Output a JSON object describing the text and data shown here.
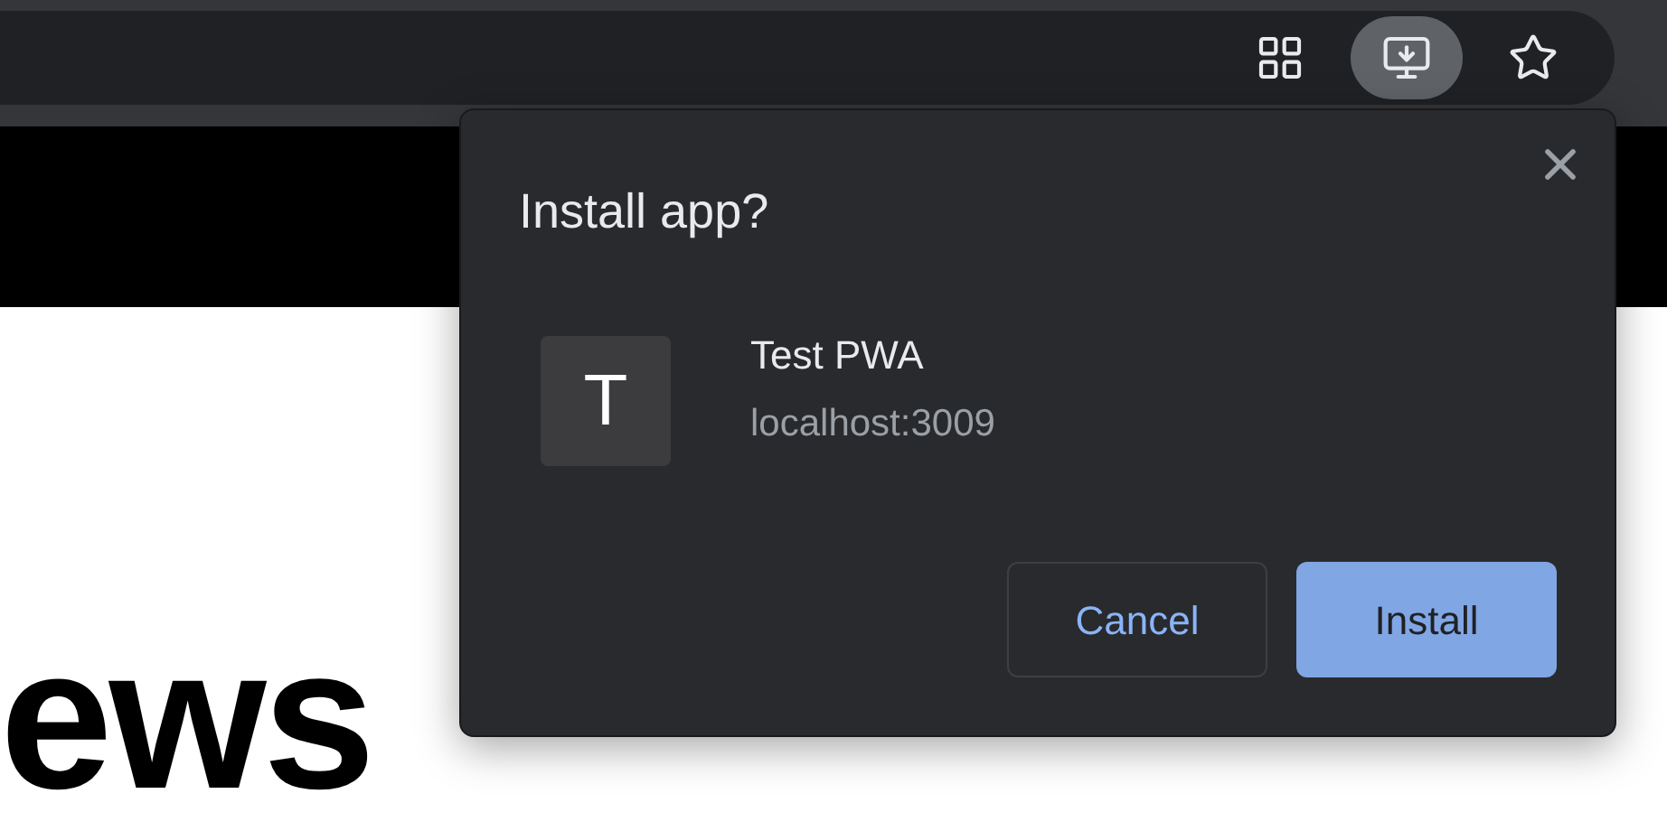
{
  "toolbar": {
    "buttons": [
      {
        "kind": "apps",
        "selected": false
      },
      {
        "kind": "install",
        "selected": true
      },
      {
        "kind": "bookmark",
        "selected": false
      }
    ]
  },
  "page": {
    "heading": "ews"
  },
  "dialog": {
    "title": "Install app?",
    "app": {
      "icon_letter": "T",
      "name": "Test PWA",
      "origin": "localhost:3009"
    },
    "buttons": [
      {
        "label": "Cancel",
        "kind": "secondary"
      },
      {
        "label": "Install",
        "kind": "primary"
      }
    ]
  }
}
